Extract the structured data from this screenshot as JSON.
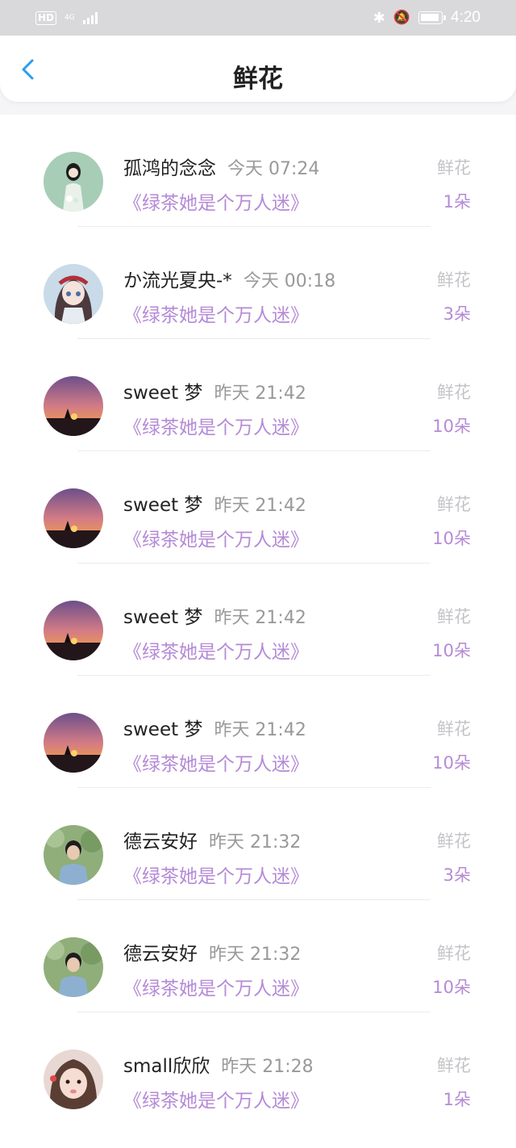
{
  "status_bar": {
    "hd": "HD",
    "network": "4G",
    "time": "4:20"
  },
  "nav": {
    "title": "鲜花"
  },
  "records": [
    {
      "user": "孤鸿的念念",
      "time": "今天 07:24",
      "book": "《绿茶她是个万人迷》",
      "gift": "鲜花",
      "count": "1朵",
      "avatar": "girl-illustration-avatar"
    },
    {
      "user": "か流光夏央-*",
      "time": "今天 00:18",
      "book": "《绿茶她是个万人迷》",
      "gift": "鲜花",
      "count": "3朵",
      "avatar": "anime-girl-avatar"
    },
    {
      "user": "sweet 梦",
      "time": "昨天 21:42",
      "book": "《绿茶她是个万人迷》",
      "gift": "鲜花",
      "count": "10朵",
      "avatar": "sunset-avatar"
    },
    {
      "user": "sweet 梦",
      "time": "昨天 21:42",
      "book": "《绿茶她是个万人迷》",
      "gift": "鲜花",
      "count": "10朵",
      "avatar": "sunset-avatar"
    },
    {
      "user": "sweet 梦",
      "time": "昨天 21:42",
      "book": "《绿茶她是个万人迷》",
      "gift": "鲜花",
      "count": "10朵",
      "avatar": "sunset-avatar"
    },
    {
      "user": "sweet 梦",
      "time": "昨天 21:42",
      "book": "《绿茶她是个万人迷》",
      "gift": "鲜花",
      "count": "10朵",
      "avatar": "sunset-avatar"
    },
    {
      "user": "德云安好",
      "time": "昨天 21:32",
      "book": "《绿茶她是个万人迷》",
      "gift": "鲜花",
      "count": "3朵",
      "avatar": "boy-photo-avatar"
    },
    {
      "user": "德云安好",
      "time": "昨天 21:32",
      "book": "《绿茶她是个万人迷》",
      "gift": "鲜花",
      "count": "10朵",
      "avatar": "boy-photo-avatar"
    },
    {
      "user": "small欣欣",
      "time": "昨天 21:28",
      "book": "《绿茶她是个万人迷》",
      "gift": "鲜花",
      "count": "1朵",
      "avatar": "child-photo-avatar"
    }
  ],
  "colors": {
    "accent": "#b58ad6",
    "back_arrow": "#2c9cf0",
    "muted": "#999999",
    "gift_label": "#c4c4c8"
  }
}
